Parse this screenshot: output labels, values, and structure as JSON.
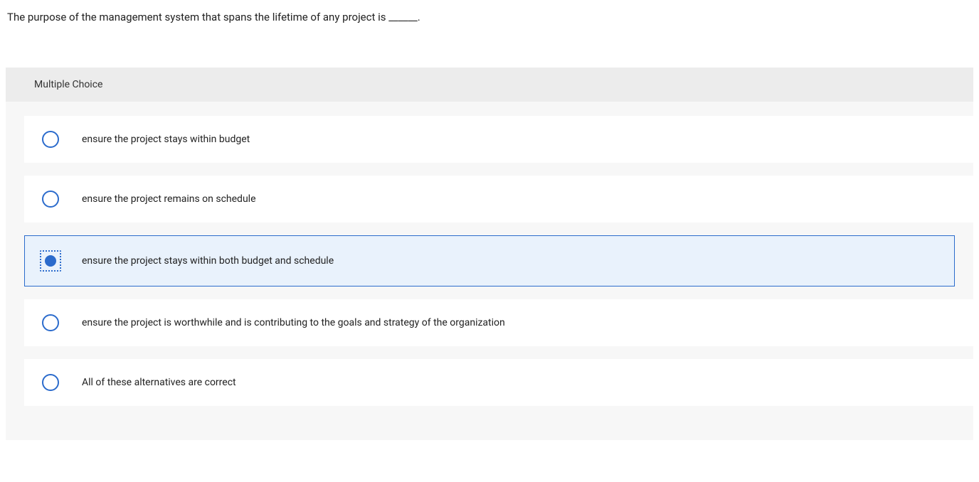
{
  "question": {
    "text": "The purpose of the management system that spans the lifetime of any project is ______."
  },
  "section": {
    "header": "Multiple Choice"
  },
  "options": [
    {
      "label": "ensure the project stays within budget",
      "selected": false
    },
    {
      "label": "ensure the project remains on schedule",
      "selected": false
    },
    {
      "label": "ensure the project stays within both budget and schedule",
      "selected": true
    },
    {
      "label": "ensure the project is worthwhile and is contributing to the goals and strategy of the organization",
      "selected": false
    },
    {
      "label": "All of these alternatives are correct",
      "selected": false
    }
  ]
}
